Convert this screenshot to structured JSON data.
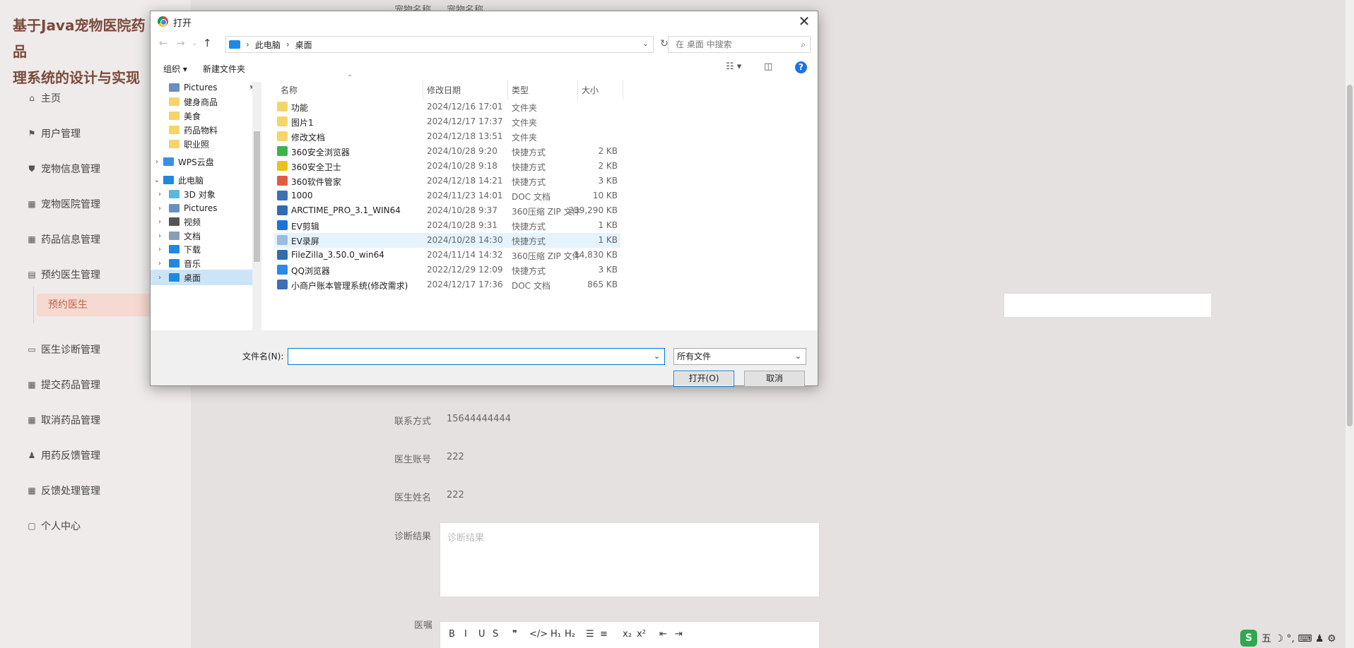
{
  "app": {
    "title": "基于Java宠物医院药品\n理系统的设计与实现",
    "menu": [
      {
        "label": "主页",
        "icon": "home-icon"
      },
      {
        "label": "用户管理",
        "icon": "flag-icon"
      },
      {
        "label": "宠物信息管理",
        "icon": "tag-icon"
      },
      {
        "label": "宠物医院管理",
        "icon": "grid-icon"
      },
      {
        "label": "药品信息管理",
        "icon": "grid-icon"
      },
      {
        "label": "预约医生管理",
        "icon": "calendar-icon"
      },
      {
        "label": "医生诊断管理",
        "icon": "briefcase-icon"
      },
      {
        "label": "提交药品管理",
        "icon": "grid-icon"
      },
      {
        "label": "取消药品管理",
        "icon": "grid-icon"
      },
      {
        "label": "用药反馈管理",
        "icon": "user-icon"
      },
      {
        "label": "反馈处理管理",
        "icon": "grid-icon"
      },
      {
        "label": "个人中心",
        "icon": "card-icon"
      }
    ],
    "submenu_active": "预约医生"
  },
  "form": {
    "top_label": "宠物名称",
    "top_value": "宠物名称",
    "contact_label": "联系方式",
    "contact_value": "15644444444",
    "doctor_account_label": "医生账号",
    "doctor_account_value": "222",
    "doctor_name_label": "医生姓名",
    "doctor_name_value": "222",
    "diagnosis_label": "诊断结果",
    "diagnosis_placeholder": "诊断结果",
    "advice_label": "医嘱",
    "editor_buttons": [
      "B",
      "I",
      "U",
      "S",
      "❞",
      "</>",
      "H₁",
      "H₂",
      "☰",
      "≡",
      "x₂",
      "x²",
      "⇤",
      "⇥"
    ]
  },
  "dialog": {
    "title": "打开",
    "path": [
      "此电脑",
      "桌面"
    ],
    "search_placeholder": "在 桌面 中搜索",
    "organize": "组织 ▾",
    "new_folder": "新建文件夹",
    "nav": [
      {
        "label": "Pictures",
        "color": "#6a8fbf",
        "chev": "",
        "indent": 1,
        "pin": true
      },
      {
        "label": "健身商品",
        "color": "#f5d46b",
        "chev": "",
        "indent": 1
      },
      {
        "label": "美食",
        "color": "#f5d46b",
        "chev": "",
        "indent": 1
      },
      {
        "label": "药品物料",
        "color": "#f5d46b",
        "chev": "",
        "indent": 1
      },
      {
        "label": "职业照",
        "color": "#f5d46b",
        "chev": "",
        "indent": 1
      },
      {
        "label": "WPS云盘",
        "color": "#3a8ee6",
        "chev": "›",
        "indent": 0
      },
      {
        "label": "此电脑",
        "color": "#1e88e5",
        "chev": "⌄",
        "indent": 0
      },
      {
        "label": "3D 对象",
        "color": "#5bb8d8",
        "chev": "›",
        "indent": 1
      },
      {
        "label": "Pictures",
        "color": "#6a8fbf",
        "chev": "›",
        "indent": 1
      },
      {
        "label": "视频",
        "color": "#555555",
        "chev": "›",
        "indent": 1
      },
      {
        "label": "文档",
        "color": "#8a9db8",
        "chev": "›",
        "indent": 1
      },
      {
        "label": "下载",
        "color": "#1e88e5",
        "chev": "›",
        "indent": 1
      },
      {
        "label": "音乐",
        "color": "#1e88e5",
        "chev": "›",
        "indent": 1
      },
      {
        "label": "桌面",
        "color": "#1e88e5",
        "chev": "›",
        "indent": 1,
        "selected": true
      }
    ],
    "columns": {
      "name": "名称",
      "date": "修改日期",
      "type": "类型",
      "size": "大小"
    },
    "files": [
      {
        "name": "功能",
        "date": "2024/12/16 17:01",
        "type": "文件夹",
        "size": "",
        "color": "#f5d46b"
      },
      {
        "name": "图片1",
        "date": "2024/12/17 17:37",
        "type": "文件夹",
        "size": "",
        "color": "#f5d46b"
      },
      {
        "name": "修改文档",
        "date": "2024/12/18 13:51",
        "type": "文件夹",
        "size": "",
        "color": "#f5d46b"
      },
      {
        "name": "360安全浏览器",
        "date": "2024/10/28 9:20",
        "type": "快捷方式",
        "size": "2 KB",
        "color": "#3cb44b"
      },
      {
        "name": "360安全卫士",
        "date": "2024/10/28 9:18",
        "type": "快捷方式",
        "size": "2 KB",
        "color": "#e8c31a"
      },
      {
        "name": "360软件管家",
        "date": "2024/12/18 14:21",
        "type": "快捷方式",
        "size": "3 KB",
        "color": "#e05a47"
      },
      {
        "name": "1000",
        "date": "2024/11/23 14:01",
        "type": "DOC 文档",
        "size": "10 KB",
        "color": "#3e6fb5"
      },
      {
        "name": "ARCTIME_PRO_3.1_WIN64",
        "date": "2024/10/28 9:37",
        "type": "360压缩 ZIP 文件",
        "size": "239,290 KB",
        "color": "#2f6db0"
      },
      {
        "name": "EV剪辑",
        "date": "2024/10/28 9:31",
        "type": "快捷方式",
        "size": "1 KB",
        "color": "#1b74d8"
      },
      {
        "name": "EV录屏",
        "date": "2024/10/28 14:30",
        "type": "快捷方式",
        "size": "1 KB",
        "color": "#9bbbe0",
        "hover": true
      },
      {
        "name": "FileZilla_3.50.0_win64",
        "date": "2024/11/14 14:32",
        "type": "360压缩 ZIP 文件",
        "size": "14,830 KB",
        "color": "#2f6db0"
      },
      {
        "name": "QQ浏览器",
        "date": "2022/12/29 12:09",
        "type": "快捷方式",
        "size": "3 KB",
        "color": "#2b8ae6"
      },
      {
        "name": "小商户账本管理系统(修改需求)",
        "date": "2024/12/17 17:36",
        "type": "DOC 文档",
        "size": "865 KB",
        "color": "#3e6fb5"
      }
    ],
    "filename_label": "文件名(N):",
    "filename_value": "",
    "filetype": "所有文件",
    "open_button": "打开(O)",
    "cancel_button": "取消"
  },
  "ime": {
    "label": "五 ☽ °, ⌨ ♟ ⚙"
  }
}
